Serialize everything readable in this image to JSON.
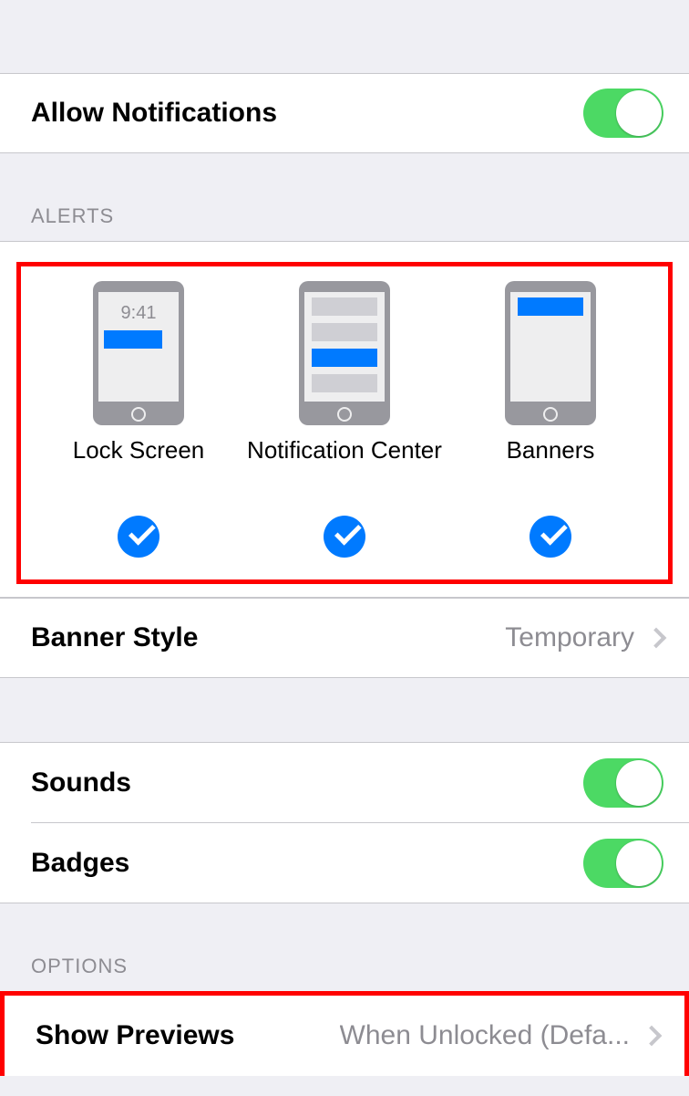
{
  "allowNotifications": {
    "label": "Allow Notifications",
    "on": true
  },
  "sections": {
    "alerts": {
      "header": "ALERTS",
      "options": [
        {
          "id": "lock_screen",
          "label": "Lock Screen",
          "checked": true,
          "time": "9:41"
        },
        {
          "id": "notification_center",
          "label": "Notification Center",
          "checked": true
        },
        {
          "id": "banners",
          "label": "Banners",
          "checked": true
        }
      ]
    },
    "bannerStyle": {
      "label": "Banner Style",
      "value": "Temporary"
    },
    "sounds": {
      "label": "Sounds",
      "on": true
    },
    "badges": {
      "label": "Badges",
      "on": true
    },
    "options": {
      "header": "OPTIONS",
      "showPreviews": {
        "label": "Show Previews",
        "value": "When Unlocked (Defa..."
      }
    }
  },
  "colors": {
    "accent": "#007aff",
    "switchOn": "#4cd964",
    "background": "#efeff4",
    "separator": "#c7c7cc",
    "secondaryText": "#8d8c92",
    "highlight": "#ff0000"
  }
}
